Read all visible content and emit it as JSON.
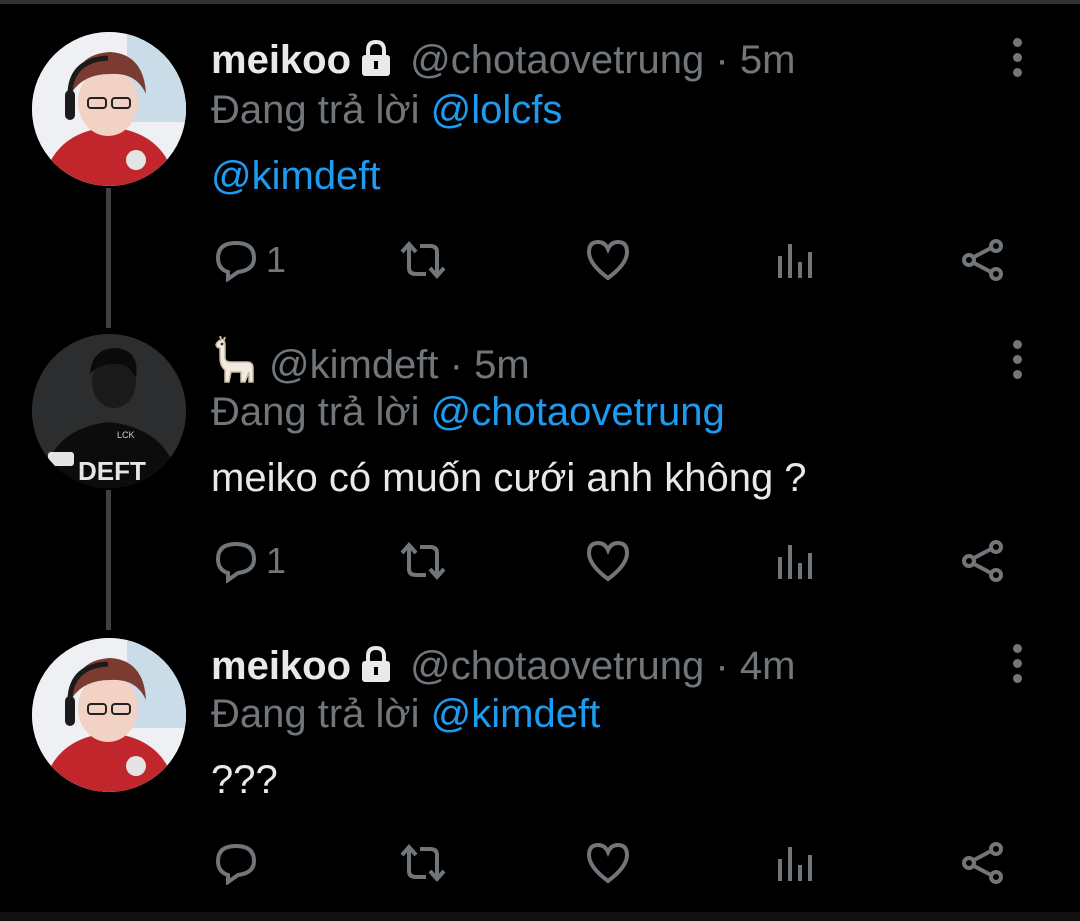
{
  "tweets": [
    {
      "name": "meikoo",
      "handle": "@chotaovetrung",
      "sep": "·",
      "time": "5m",
      "reply_prefix": "Đang trả lời",
      "reply_to": "@lolcfs",
      "body_link": "@kimdeft",
      "reply_count": "1",
      "avatar": "meikoo-avatar"
    },
    {
      "name_emoji": "llama-icon",
      "handle": "@kimdeft",
      "sep": "·",
      "time": "5m",
      "reply_prefix": "Đang trả lời",
      "reply_to": "@chotaovetrung",
      "body": "meiko có muốn cưới anh không ?",
      "reply_count": "1",
      "avatar_text": "DEFT",
      "avatar_jersey": "LCK"
    },
    {
      "name": "meikoo",
      "handle": "@chotaovetrung",
      "sep": "·",
      "time": "4m",
      "reply_prefix": "Đang trả lời",
      "reply_to": "@kimdeft",
      "body": "???",
      "reply_count": "",
      "avatar": "meikoo-avatar"
    }
  ],
  "icons": [
    "reply-icon",
    "retweet-icon",
    "like-icon",
    "views-icon",
    "share-icon",
    "more-icon",
    "lock-icon"
  ],
  "colors": {
    "background": "#000000",
    "text": "#e7e9ea",
    "muted": "#71767b",
    "link": "#1d9bf0"
  }
}
